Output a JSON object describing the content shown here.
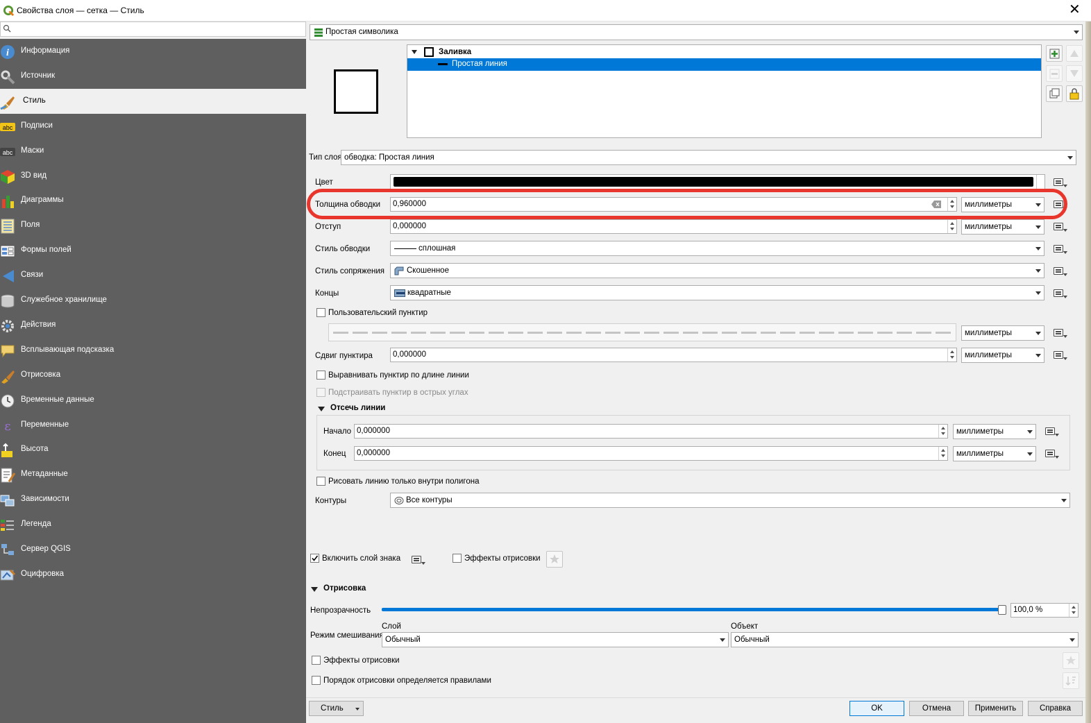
{
  "window": {
    "title": "Свойства слоя — сетка — Стиль",
    "close": "✕"
  },
  "search": {
    "placeholder": ""
  },
  "sidebar": {
    "items": [
      {
        "label": "Информация",
        "icon": "info-icon"
      },
      {
        "label": "Источник",
        "icon": "source-icon"
      },
      {
        "label": "Стиль",
        "icon": "style-brush-icon"
      },
      {
        "label": "Подписи",
        "icon": "labels-abc-icon"
      },
      {
        "label": "Маски",
        "icon": "masks-abc-icon"
      },
      {
        "label": "3D вид",
        "icon": "3d-cube-icon"
      },
      {
        "label": "Диаграммы",
        "icon": "diagrams-icon"
      },
      {
        "label": "Поля",
        "icon": "fields-icon"
      },
      {
        "label": "Формы полей",
        "icon": "forms-icon"
      },
      {
        "label": "Связи",
        "icon": "joins-icon"
      },
      {
        "label": "Служебное хранилище",
        "icon": "storage-icon"
      },
      {
        "label": "Действия",
        "icon": "actions-gear-icon"
      },
      {
        "label": "Всплывающая подсказка",
        "icon": "tooltip-bubble-icon"
      },
      {
        "label": "Отрисовка",
        "icon": "rendering-brush-icon"
      },
      {
        "label": "Временные данные",
        "icon": "clock-icon"
      },
      {
        "label": "Переменные",
        "icon": "epsilon-icon"
      },
      {
        "label": "Высота",
        "icon": "elevation-icon"
      },
      {
        "label": "Метаданные",
        "icon": "metadata-icon"
      },
      {
        "label": "Зависимости",
        "icon": "dependencies-icon"
      },
      {
        "label": "Легенда",
        "icon": "legend-icon"
      },
      {
        "label": "Сервер QGIS",
        "icon": "server-icon"
      },
      {
        "label": "Оцифровка",
        "icon": "digitizing-icon"
      }
    ],
    "active_index": 2
  },
  "renderer": {
    "value": "Простая символика"
  },
  "symbol_tree": {
    "root": "Заливка",
    "child": "Простая линия"
  },
  "layer_type": {
    "label": "Тип слоя",
    "value": "обводка: Простая линия"
  },
  "props": {
    "color_label": "Цвет",
    "color_value": "#000000",
    "width_label": "Толщина обводки",
    "width_value": "0,960000",
    "width_unit": "миллиметры",
    "offset_label": "Отступ",
    "offset_value": "0,000000",
    "offset_unit": "миллиметры",
    "stroke_style_label": "Стиль обводки",
    "stroke_style_value": "сплошная",
    "join_label": "Стиль сопряжения",
    "join_value": "Скошенное",
    "cap_label": "Концы",
    "cap_value": "квадратные",
    "custom_dash_label": "Пользовательский пунктир",
    "custom_dash_unit": "миллиметры",
    "dash_offset_label": "Сдвиг пунктира",
    "dash_offset_value": "0,000000",
    "dash_offset_unit": "миллиметры",
    "align_dash_label": "Выравнивать пунктир по длине линии",
    "tweak_dash_label": "Подстраивать пунктир в острых углах",
    "trim_header": "Отсечь линии",
    "trim_start_label": "Начало",
    "trim_start_value": "0,000000",
    "trim_start_unit": "миллиметры",
    "trim_end_label": "Конец",
    "trim_end_value": "0,000000",
    "trim_end_unit": "миллиметры",
    "inside_polygon_label": "Рисовать линию только внутри полигона",
    "rings_label": "Контуры",
    "rings_value": "Все контуры",
    "enable_layer_label": "Включить слой знака",
    "effects_label": "Эффекты отрисовки"
  },
  "rendering": {
    "header": "Отрисовка",
    "opacity_label": "Непрозрачность",
    "opacity_value": "100,0 %",
    "opacity_fraction": 1.0,
    "blend_label": "Режим смешивания",
    "layer_label": "Слой",
    "layer_value": "Обычный",
    "object_label": "Объект",
    "object_value": "Обычный",
    "effects_label": "Эффекты отрисовки",
    "order_label": "Порядок отрисовки определяется правилами"
  },
  "footer": {
    "style_button": "Стиль",
    "ok": "OK",
    "cancel": "Отмена",
    "apply": "Применить",
    "help": "Справка"
  },
  "highlight_color": "#e8362d",
  "selection_color": "#0078d7"
}
